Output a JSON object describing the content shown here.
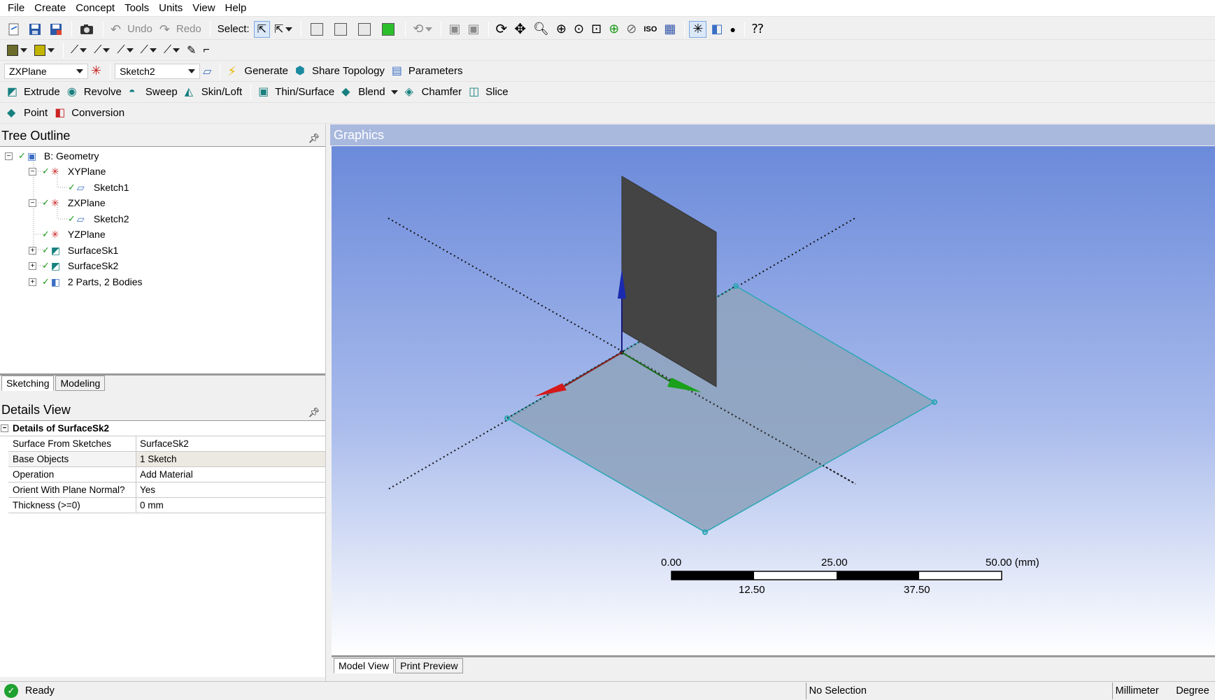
{
  "menu": [
    "File",
    "Create",
    "Concept",
    "Tools",
    "Units",
    "View",
    "Help"
  ],
  "toolbar1": {
    "undo": "Undo",
    "redo": "Redo",
    "select_label": "Select:"
  },
  "toolbar3": {
    "plane": "ZXPlane",
    "sketch": "Sketch2",
    "generate": "Generate",
    "share_topology": "Share Topology",
    "parameters": "Parameters"
  },
  "toolbar4": {
    "extrude": "Extrude",
    "revolve": "Revolve",
    "sweep": "Sweep",
    "skin_loft": "Skin/Loft",
    "thin_surface": "Thin/Surface",
    "blend": "Blend",
    "chamfer": "Chamfer",
    "slice": "Slice"
  },
  "toolbar5": {
    "point": "Point",
    "conversion": "Conversion"
  },
  "tree_outline": {
    "title": "Tree Outline",
    "items": [
      "B: Geometry",
      "XYPlane",
      "Sketch1",
      "ZXPlane",
      "Sketch2",
      "YZPlane",
      "SurfaceSk1",
      "SurfaceSk2",
      "2 Parts, 2 Bodies"
    ]
  },
  "tabs": {
    "sketching": "Sketching",
    "modeling": "Modeling"
  },
  "details_view": {
    "title": "Details View",
    "header": "Details of SurfaceSk2",
    "rows": [
      {
        "key": "Surface From Sketches",
        "value": "SurfaceSk2"
      },
      {
        "key": "Base Objects",
        "value": "1 Sketch"
      },
      {
        "key": "Operation",
        "value": "Add Material"
      },
      {
        "key": "Orient With Plane Normal?",
        "value": "Yes"
      },
      {
        "key": "Thickness (>=0)",
        "value": "0 mm"
      }
    ]
  },
  "graphics": {
    "title": "Graphics",
    "scale": {
      "top_labels": [
        "0.00",
        "25.00",
        "50.00 (mm)"
      ],
      "bottom_labels": [
        "12.50",
        "37.50"
      ]
    },
    "view_tabs": {
      "model_view": "Model View",
      "print_preview": "Print Preview"
    }
  },
  "status": {
    "ready": "Ready",
    "selection": "No Selection",
    "length_unit": "Millimeter",
    "angle_unit": "Degree"
  },
  "colors": {
    "graphics_top": "#6b8ada",
    "graphics_title": "#a9b8dd",
    "plane_dark": "#444444",
    "plane_light": "#8fa4bf",
    "edge": "#2aa6b4"
  }
}
